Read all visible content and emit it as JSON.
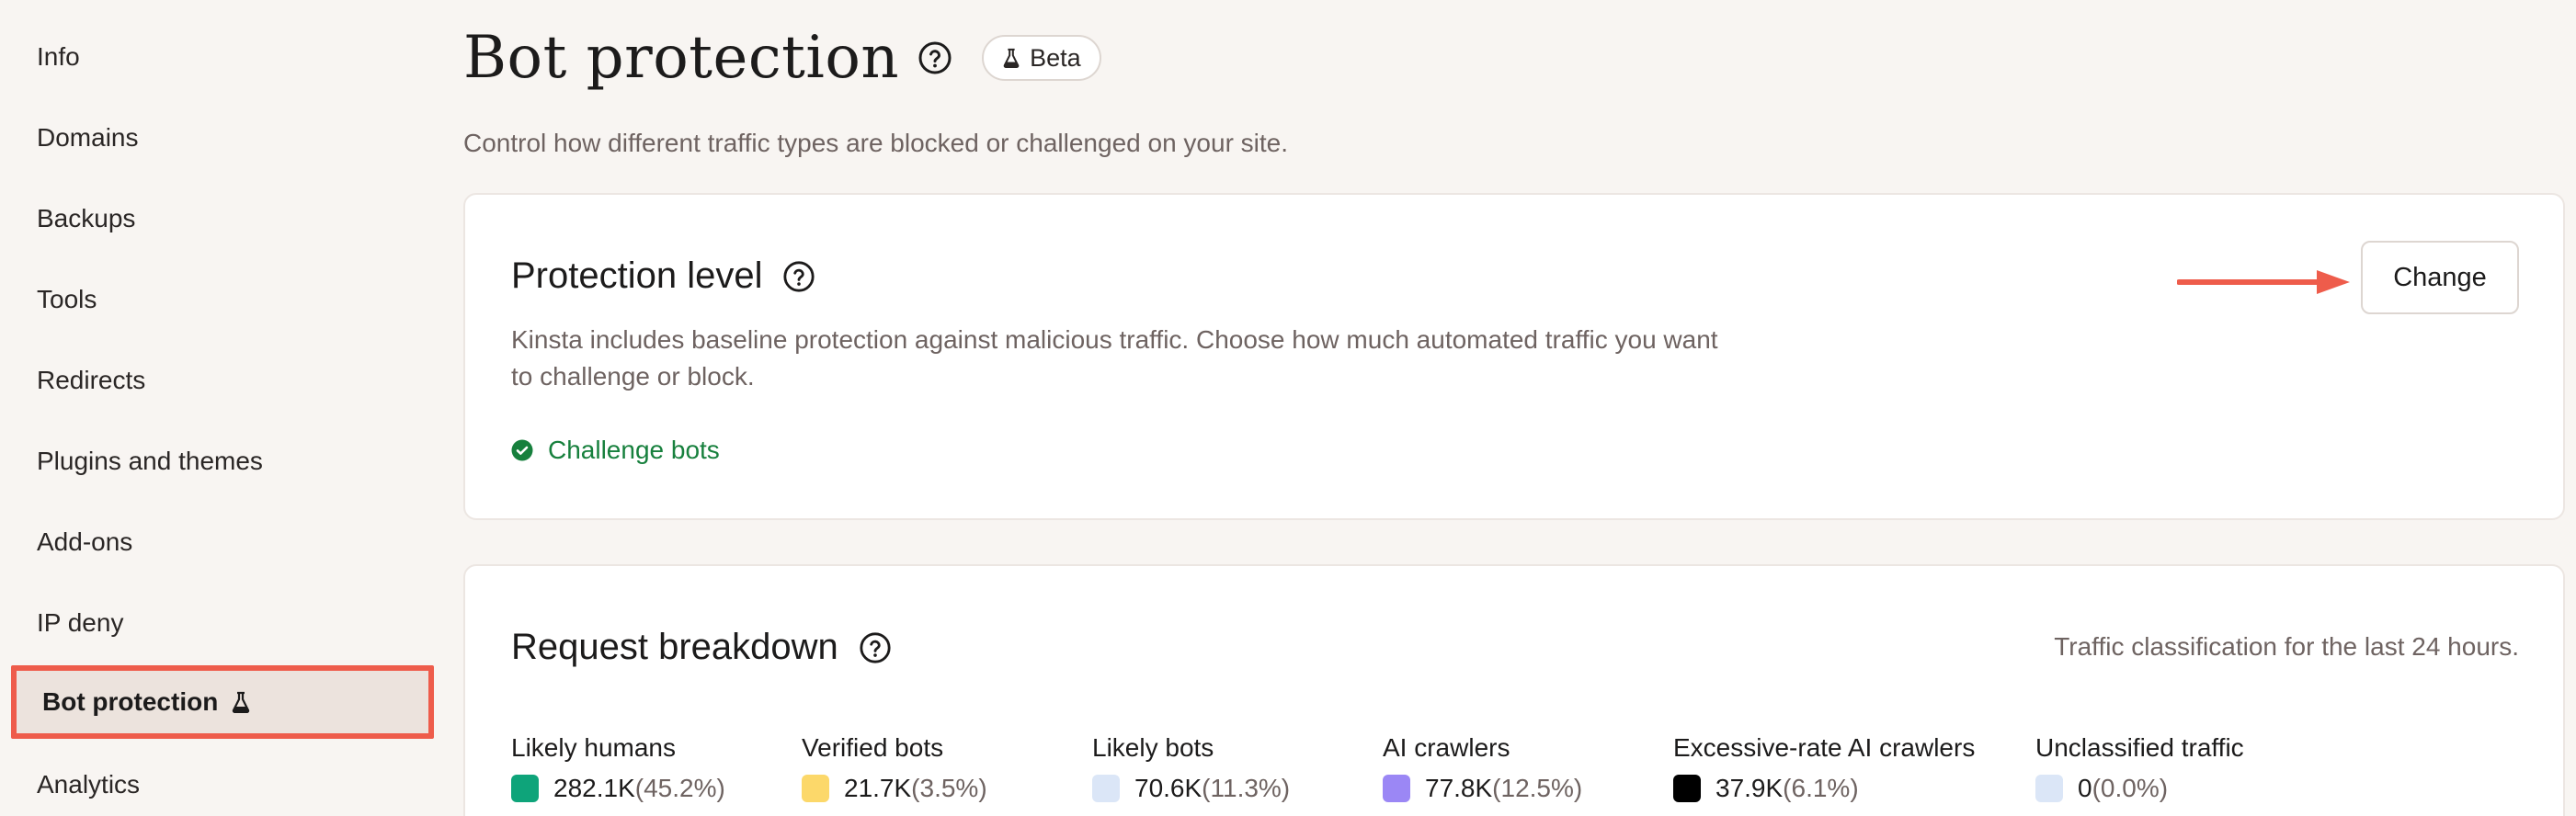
{
  "sidebar": {
    "items": [
      {
        "label": "Info"
      },
      {
        "label": "Domains"
      },
      {
        "label": "Backups"
      },
      {
        "label": "Tools"
      },
      {
        "label": "Redirects"
      },
      {
        "label": "Plugins and themes"
      },
      {
        "label": "Add-ons"
      },
      {
        "label": "IP deny"
      },
      {
        "label": "Bot protection",
        "active": true,
        "icon": "flask-icon"
      },
      {
        "label": "Analytics"
      }
    ]
  },
  "header": {
    "title": "Bot protection",
    "badge": "Beta",
    "subtitle": "Control how different traffic types are blocked or challenged on your site."
  },
  "protection": {
    "title": "Protection level",
    "description": "Kinsta includes baseline protection against malicious traffic. Choose how much automated traffic you want to challenge or block.",
    "status": "Challenge bots",
    "change_label": "Change"
  },
  "requests": {
    "title": "Request breakdown",
    "note": "Traffic classification for the last 24 hours.",
    "stats": [
      {
        "label": "Likely humans",
        "value": "282.1K",
        "pct": "(45.2%)",
        "color": "#0ea47a"
      },
      {
        "label": "Verified bots",
        "value": "21.7K",
        "pct": "(3.5%)",
        "color": "#fcd86a"
      },
      {
        "label": "Likely bots",
        "value": "70.6K",
        "pct": "(11.3%)",
        "color": "#dbe6f7"
      },
      {
        "label": "AI crawlers",
        "value": "77.8K",
        "pct": "(12.5%)",
        "color": "#9b87f5"
      },
      {
        "label": "Excessive-rate AI crawlers",
        "value": "37.9K",
        "pct": "(6.1%)",
        "color": "#000000"
      },
      {
        "label": "Unclassified traffic",
        "value": "0",
        "pct": "(0.0%)",
        "color": "#dbe6f7"
      }
    ]
  },
  "colors": {
    "accent_red": "#ee5c4b",
    "success_green": "#17803d"
  }
}
